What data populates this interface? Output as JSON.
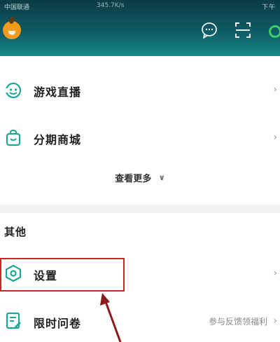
{
  "status_bar": {
    "carrier": "中国联通",
    "speed": "345.7K/s",
    "time": "下午"
  },
  "header": {
    "chat_icon": "chat-bubble-icon",
    "scan_icon": "scan-icon"
  },
  "menu": {
    "items": [
      {
        "label": "游戏直播",
        "icon": "game-live-icon"
      },
      {
        "label": "分期商城",
        "icon": "mall-bag-icon"
      }
    ],
    "more_label": "查看更多"
  },
  "other_section": {
    "title": "其他",
    "items": [
      {
        "label": "设置",
        "icon": "settings-icon"
      },
      {
        "label": "限时问卷",
        "icon": "survey-icon",
        "note": "参与反馈领福利"
      }
    ]
  },
  "colors": {
    "header_top": "#0d3b44",
    "header_bottom": "#128b86",
    "accent_green": "#1aa896",
    "highlight_red": "#c62828"
  }
}
